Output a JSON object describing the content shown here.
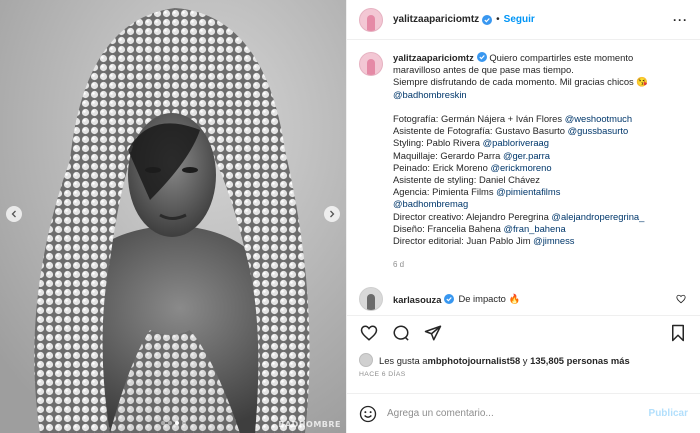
{
  "media": {
    "watermark": "BADHOMBRE",
    "carousel_dots": 4,
    "active_dot": 2
  },
  "header": {
    "username": "yalitzaapariciomtz",
    "separator": "•",
    "follow_label": "Seguir",
    "more_label": "···"
  },
  "caption": {
    "username": "yalitzaapariciomtz",
    "lines": [
      [
        {
          "t": "Quiero compartirles este momento"
        }
      ],
      [
        {
          "t": "maravilloso antes de que pase mas tiempo."
        }
      ],
      [
        {
          "t": "Siempre disfrutando de cada momento. Mil gracias chicos 😘"
        }
      ],
      [
        {
          "t": "@badhombreskin",
          "link": true
        }
      ],
      [
        {
          "t": ""
        }
      ],
      [
        {
          "t": "Fotografía: Germán Nájera + Iván Flores "
        },
        {
          "t": "@weshootmuch",
          "link": true
        }
      ],
      [
        {
          "t": "Asistente de Fotografía: Gustavo Basurto "
        },
        {
          "t": "@gussbasurto",
          "link": true
        }
      ],
      [
        {
          "t": "Styling: Pablo Rivera "
        },
        {
          "t": "@pabloriveraag",
          "link": true
        }
      ],
      [
        {
          "t": "Maquillaje: Gerardo Parra "
        },
        {
          "t": "@ger.parra",
          "link": true
        }
      ],
      [
        {
          "t": "Peinado: Erick Moreno "
        },
        {
          "t": "@erickmoreno",
          "link": true
        }
      ],
      [
        {
          "t": "Asistente de styling: Daniel Chávez"
        }
      ],
      [
        {
          "t": "Agencia: Pimienta Films "
        },
        {
          "t": "@pimientafilms",
          "link": true
        }
      ],
      [
        {
          "t": "@badhombremag",
          "link": true
        }
      ],
      [
        {
          "t": "Director creativo: Alejandro Peregrina "
        },
        {
          "t": "@alejandroperegrina_",
          "link": true
        }
      ],
      [
        {
          "t": "Diseño: Francelia Bahena "
        },
        {
          "t": "@fran_bahena",
          "link": true
        }
      ],
      [
        {
          "t": "Director editorial: Juan Pablo Jim "
        },
        {
          "t": "@jimness",
          "link": true
        }
      ]
    ],
    "time": "6 d"
  },
  "comment": {
    "username": "karlasouza",
    "text": "De impacto 🔥"
  },
  "likes": {
    "prefix": "Les gusta a ",
    "user": "mbphotojournalist58",
    "middle": " y ",
    "count": "135,805 personas más"
  },
  "date": "HACE 6 DÍAS",
  "add_comment": {
    "placeholder": "Agrega un comentario...",
    "publish_label": "Publicar"
  },
  "colors": {
    "accent": "#0095f6",
    "link": "#00376b",
    "publish_disabled": "#b2dffc",
    "verified": "#3897f0"
  }
}
